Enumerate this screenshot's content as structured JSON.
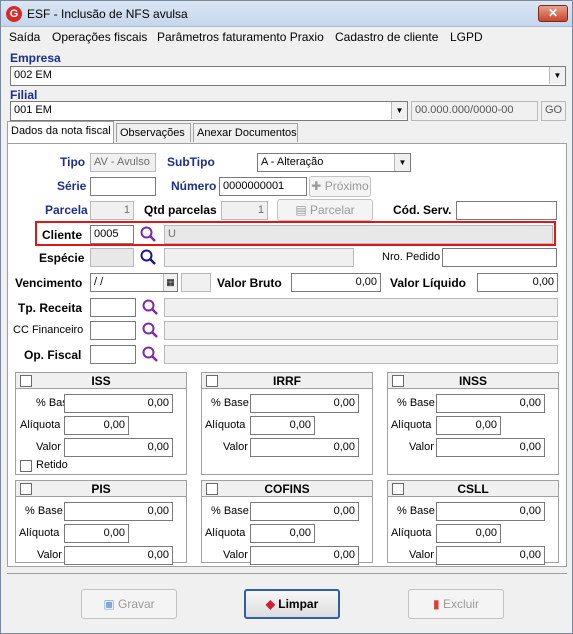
{
  "window": {
    "title": "ESF - Inclusão de NFS avulsa",
    "icon_letter": "G",
    "close": "✕"
  },
  "menu": [
    {
      "label": "Saída"
    },
    {
      "label": "Operações fiscais"
    },
    {
      "label": "Parâmetros faturamento Praxio"
    },
    {
      "label": "Cadastro de cliente"
    },
    {
      "label": "LGPD"
    }
  ],
  "empresa": {
    "label": "Empresa",
    "value": "002 EM"
  },
  "filial": {
    "label": "Filial",
    "value": "001 EM",
    "cnpj": "00.000.000/0000-00",
    "uf": "GO"
  },
  "tabs": [
    {
      "label": "Dados da nota fiscal"
    },
    {
      "label": "Observações"
    },
    {
      "label": "Anexar Documentos"
    }
  ],
  "form": {
    "tipo_label": "Tipo",
    "tipo_value": "AV - Avulso",
    "subtipo_label": "SubTipo",
    "subtipo_value": "A - Alteração",
    "serie_label": "Série",
    "serie_value": "",
    "numero_label": "Número",
    "numero_value": "0000000001",
    "proximo_label": "Próximo",
    "parcela_label": "Parcela",
    "parcela_value": "1",
    "qtd_parcelas_label": "Qtd parcelas",
    "qtd_parcelas_value": "1",
    "parcelar_label": "Parcelar",
    "cod_serv_label": "Cód. Serv.",
    "cod_serv_value": "",
    "cliente_label": "Cliente",
    "cliente_code": "0005",
    "cliente_name": "U",
    "especie_label": "Espécie",
    "nro_pedido_label": "Nro. Pedido",
    "nro_pedido_value": "",
    "vencimento_label": "Vencimento",
    "vencimento_value": "/ /",
    "valor_bruto_label": "Valor Bruto",
    "valor_bruto_value": "0,00",
    "valor_liquido_label": "Valor Líquido",
    "valor_liquido_value": "0,00",
    "tp_receita_label": "Tp. Receita",
    "cc_financeiro_label": "CC Financeiro",
    "op_fiscal_label": "Op. Fiscal"
  },
  "taxes": [
    {
      "name": "ISS",
      "base_label": "% Base",
      "base": "0,00",
      "aliquota_label": "Alíquota",
      "aliquota": "0,00",
      "valor_label": "Valor",
      "valor": "0,00",
      "retido_label": "Retido"
    },
    {
      "name": "IRRF",
      "base_label": "% Base",
      "base": "0,00",
      "aliquota_label": "Alíquota",
      "aliquota": "0,00",
      "valor_label": "Valor",
      "valor": "0,00"
    },
    {
      "name": "INSS",
      "base_label": "% Base",
      "base": "0,00",
      "aliquota_label": "Alíquota",
      "aliquota": "0,00",
      "valor_label": "Valor",
      "valor": "0,00"
    },
    {
      "name": "PIS",
      "base_label": "% Base",
      "base": "0,00",
      "aliquota_label": "Alíquota",
      "aliquota": "0,00",
      "valor_label": "Valor",
      "valor": "0,00"
    },
    {
      "name": "COFINS",
      "base_label": "% Base",
      "base": "0,00",
      "aliquota_label": "Alíquota",
      "aliquota": "0,00",
      "valor_label": "Valor",
      "valor": "0,00"
    },
    {
      "name": "CSLL",
      "base_label": "% Base",
      "base": "0,00",
      "aliquota_label": "Alíquota",
      "aliquota": "0,00",
      "valor_label": "Valor",
      "valor": "0,00"
    }
  ],
  "buttons": {
    "gravar": "Gravar",
    "limpar": "Limpar",
    "excluir": "Excluir"
  },
  "colors": {
    "highlight": "#e0161a",
    "label_blue": "#1c2f8a",
    "search_icon": "#7b2aa8"
  }
}
